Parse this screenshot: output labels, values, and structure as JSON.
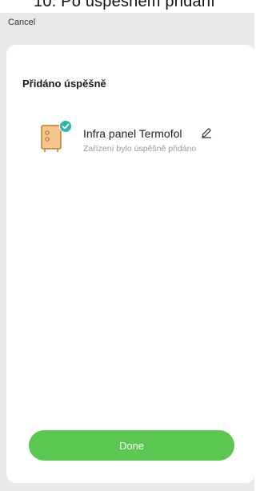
{
  "header": {
    "caption": "10. Po úspěšném přidání",
    "cancel_label": "Cancel"
  },
  "sheet": {
    "title": "Přidáno úspěšně",
    "device": {
      "name": "Infra panel Termofol",
      "status": "Zařízení bylo úspěšně přidáno",
      "icon": "heater-panel-icon",
      "badge_icon": "check-icon",
      "edit_icon": "pencil-icon"
    },
    "done_label": "Done"
  },
  "colors": {
    "done_button": "#5bc750",
    "badge": "#2bb5a8",
    "device_body": "#f3c68e",
    "device_outline": "#c47a2c",
    "backdrop": "#e9e9e9"
  }
}
